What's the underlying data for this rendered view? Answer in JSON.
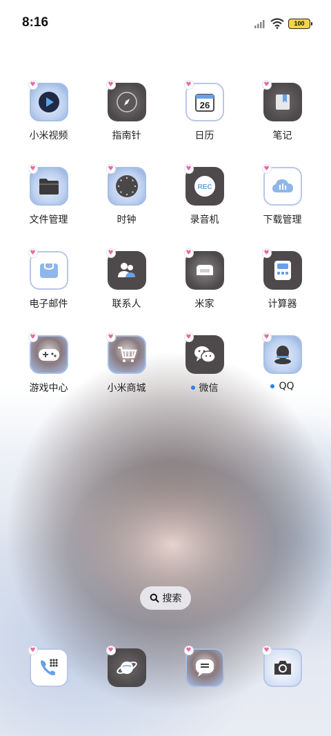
{
  "status": {
    "time": "8:16",
    "battery": "100"
  },
  "rows": [
    [
      {
        "label": "小米视频",
        "icon": "play-icon"
      },
      {
        "label": "指南针",
        "icon": "compass-icon"
      },
      {
        "label": "日历",
        "icon": "calendar-icon",
        "day": "26"
      },
      {
        "label": "笔记",
        "icon": "notes-icon"
      }
    ],
    [
      {
        "label": "文件管理",
        "icon": "folder-icon"
      },
      {
        "label": "时钟",
        "icon": "clock-icon"
      },
      {
        "label": "录音机",
        "icon": "recorder-icon",
        "badge_text": "REC"
      },
      {
        "label": "下载管理",
        "icon": "download-cloud-icon"
      }
    ],
    [
      {
        "label": "电子邮件",
        "icon": "mail-icon"
      },
      {
        "label": "联系人",
        "icon": "contacts-icon"
      },
      {
        "label": "米家",
        "icon": "home-sofa-icon"
      },
      {
        "label": "计算器",
        "icon": "calculator-icon"
      }
    ],
    [
      {
        "label": "游戏中心",
        "icon": "gamepad-icon"
      },
      {
        "label": "小米商城",
        "icon": "shop-cart-icon"
      },
      {
        "label": "微信",
        "icon": "wechat-icon"
      },
      {
        "label": "QQ",
        "icon": "qq-icon"
      }
    ]
  ],
  "search": {
    "label": "搜索"
  },
  "dock": [
    {
      "name": "phone",
      "icon": "phone-dialpad-icon"
    },
    {
      "name": "browser",
      "icon": "planet-icon"
    },
    {
      "name": "messages",
      "icon": "message-icon"
    },
    {
      "name": "camera",
      "icon": "camera-icon"
    }
  ],
  "colors": {
    "accent": "#2d7ff0",
    "dark_tile": "#4e4a4c",
    "light_border": "#b9c6e6"
  }
}
